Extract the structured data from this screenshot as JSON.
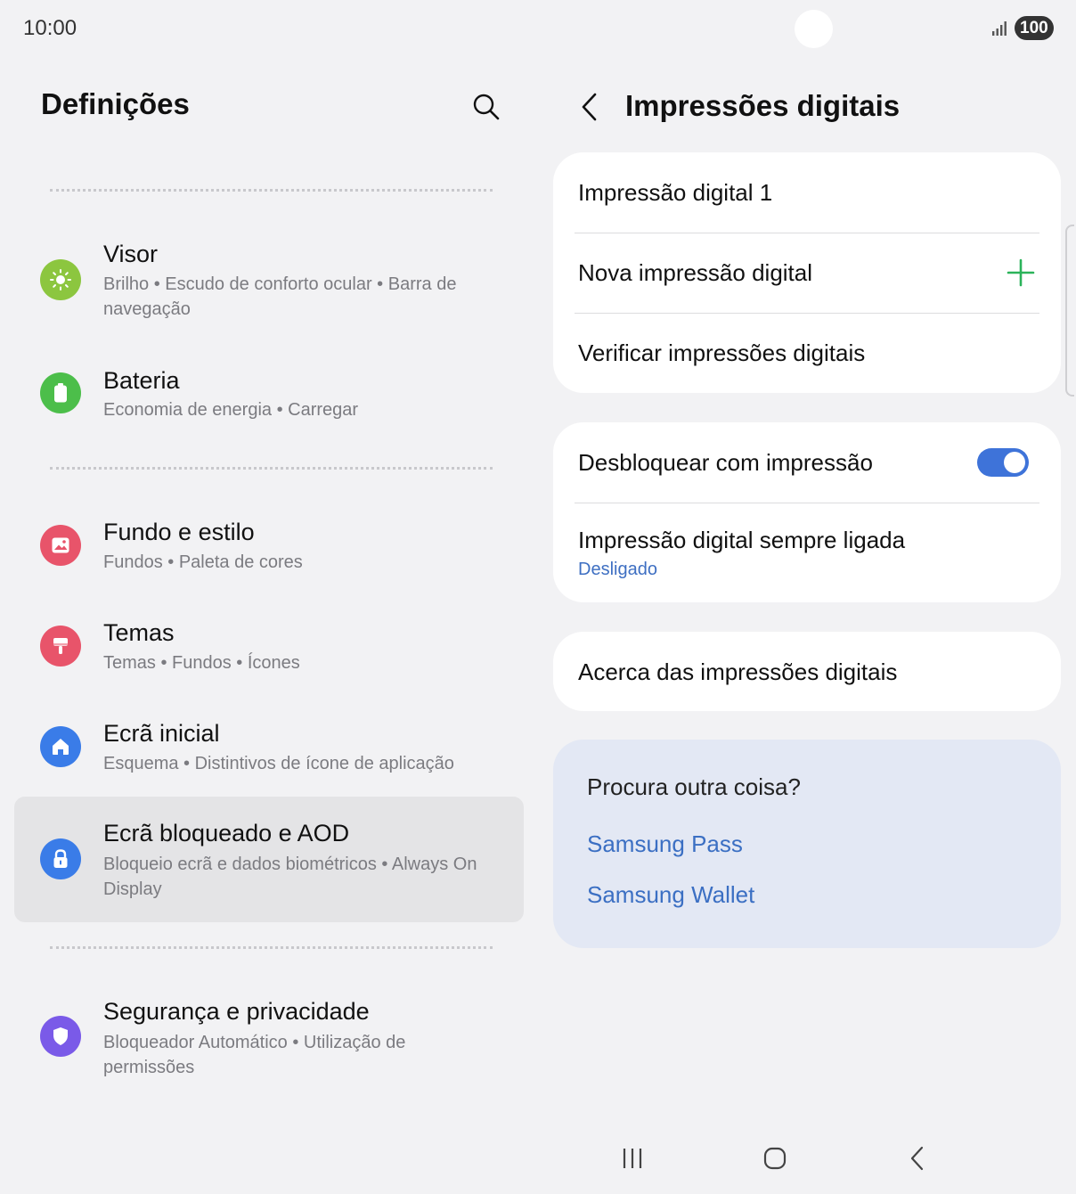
{
  "status_bar": {
    "time": "10:00",
    "battery": "100",
    "signal_icon": "signal-bars-icon"
  },
  "left": {
    "title": "Definições",
    "search_icon": "search-icon",
    "items": [
      {
        "title": "Visor",
        "subtitle": "Brilho  •  Escudo de conforto ocular  •  Barra de navegação",
        "icon": "sun-icon",
        "color": "#8cc63f"
      },
      {
        "title": "Bateria",
        "subtitle": "Economia de energia  •  Carregar",
        "icon": "battery-icon",
        "color": "#4cbe4a"
      },
      {
        "title": "Fundo e estilo",
        "subtitle": "Fundos  •  Paleta de cores",
        "icon": "image-icon",
        "color": "#e8546a"
      },
      {
        "title": "Temas",
        "subtitle": "Temas  •  Fundos  •  Ícones",
        "icon": "paint-brush-icon",
        "color": "#e8546a"
      },
      {
        "title": "Ecrã inicial",
        "subtitle": "Esquema  •  Distintivos de ícone de aplicação",
        "icon": "home-icon",
        "color": "#3a7ce8"
      },
      {
        "title": "Ecrã bloqueado e AOD",
        "subtitle": "Bloqueio ecrã e dados biométricos  •  Always On Display",
        "icon": "lock-icon",
        "color": "#3a7ce8"
      },
      {
        "title": "Segurança e privacidade",
        "subtitle": "Bloqueador Automático  •  Utilização de permissões",
        "icon": "shield-icon",
        "color": "#7a5ae8"
      }
    ]
  },
  "right": {
    "title": "Impressões digitais",
    "back_icon": "chevron-left-icon",
    "group1": {
      "fingerprint1": "Impressão digital 1",
      "add": "Nova impressão digital",
      "check": "Verificar impressões digitais"
    },
    "group2": {
      "unlock": "Desbloquear com impressão",
      "unlock_on": true,
      "always_on": "Impressão digital sempre ligada",
      "always_on_state": "Desligado"
    },
    "about": "Acerca das impressões digitais",
    "suggest": {
      "title": "Procura outra coisa?",
      "links": [
        "Samsung Pass",
        "Samsung Wallet"
      ]
    }
  },
  "colors": {
    "accent_blue": "#3e73d9",
    "link_blue": "#3b6fc3",
    "plus_green": "#2bb35a"
  },
  "navbar": {
    "recents_icon": "recents-icon",
    "home_icon": "home-button-icon",
    "back_icon": "back-icon"
  }
}
